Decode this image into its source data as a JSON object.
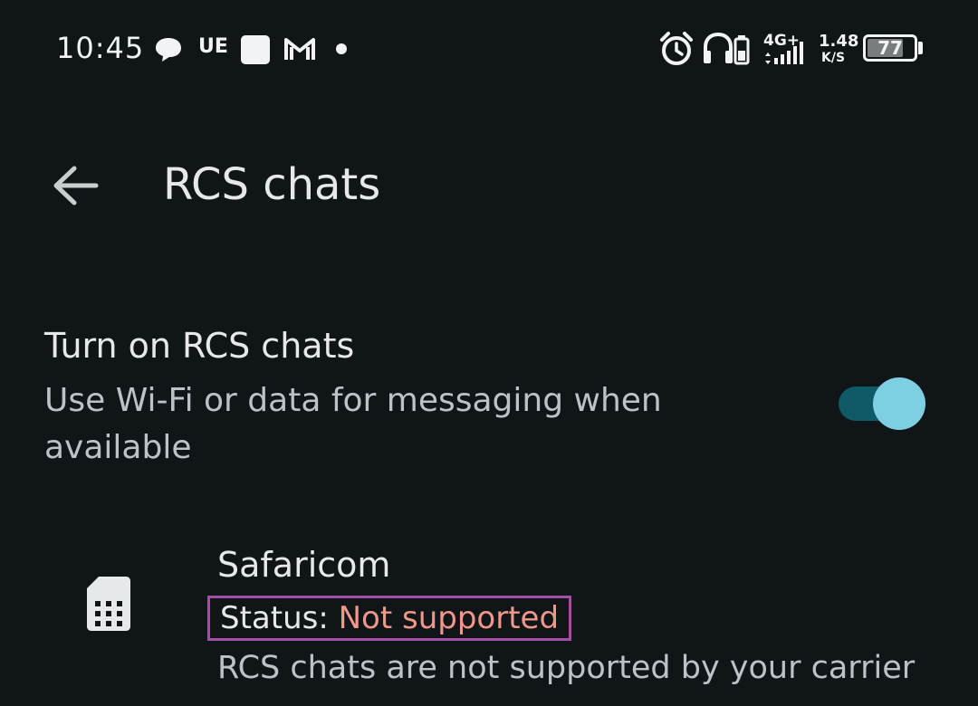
{
  "status_bar": {
    "time": "10:45",
    "carrier_indicator": "UE",
    "network_type": "4G+",
    "data_speed_value": "1.48",
    "data_speed_unit": "K/S",
    "battery_percent": "77",
    "battery_level": 0.77,
    "icons": [
      "chat-bubble-icon",
      "square-notification-icon",
      "gmail-icon",
      "dot-icon",
      "alarm-icon",
      "headphones-icon",
      "battery-saver-icon",
      "signal-icon",
      "battery-icon"
    ]
  },
  "header": {
    "back_icon": "arrow-left-icon",
    "title": "RCS chats"
  },
  "rcs_setting": {
    "title": "Turn on RCS chats",
    "description": "Use Wi-Fi or data for messaging when available",
    "toggle_on": true
  },
  "carrier": {
    "icon": "sim-card-icon",
    "name": "Safaricom",
    "status_label": "Status:",
    "status_value": "Not supported",
    "note": "RCS chats are not supported by your carrier"
  },
  "colors": {
    "background": "#101518",
    "toggle_track": "#0e5a66",
    "toggle_thumb": "#7fcfe3",
    "status_error": "#f1968a",
    "highlight_box": "#a34fa8"
  }
}
